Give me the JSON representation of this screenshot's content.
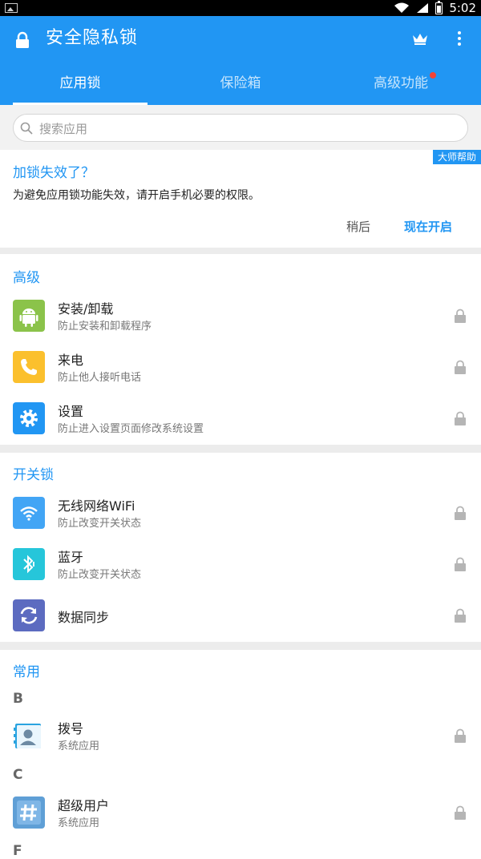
{
  "status": {
    "time": "5:02"
  },
  "appbar": {
    "title": "安全隐私锁"
  },
  "tabs": [
    {
      "label": "应用锁"
    },
    {
      "label": "保险箱"
    },
    {
      "label": "高级功能"
    }
  ],
  "search": {
    "placeholder": "搜索应用"
  },
  "banner": {
    "badge": "大师帮助",
    "title": "加锁失效了？",
    "desc": "为避免应用锁功能失效，请开启手机必要的权限。",
    "later": "稍后",
    "enable": "现在开启"
  },
  "sections": {
    "advanced": {
      "title": "高级",
      "items": [
        {
          "name": "安装/卸载",
          "sub": "防止安装和卸载程序",
          "icon": "android-icon",
          "color": "#8bc34a"
        },
        {
          "name": "来电",
          "sub": "防止他人接听电话",
          "icon": "phone-icon",
          "color": "#fbc02d"
        },
        {
          "name": "设置",
          "sub": "防止进入设置页面修改系统设置",
          "icon": "gear-icon",
          "color": "#2196f3"
        }
      ]
    },
    "switches": {
      "title": "开关锁",
      "items": [
        {
          "name": "无线网络WiFi",
          "sub": "防止改变开关状态",
          "icon": "wifi-icon",
          "color": "#42a5f5"
        },
        {
          "name": "蓝牙",
          "sub": "防止改变开关状态",
          "icon": "bluetooth-icon",
          "color": "#26c6da"
        },
        {
          "name": "数据同步",
          "sub": "",
          "icon": "sync-icon",
          "color": "#5c6bc0"
        }
      ]
    },
    "common": {
      "title": "常用",
      "groups": [
        {
          "letter": "B",
          "items": [
            {
              "name": "拨号",
              "sub": "系统应用",
              "icon": "dialer-icon"
            }
          ]
        },
        {
          "letter": "C",
          "items": [
            {
              "name": "超级用户",
              "sub": "系统应用",
              "icon": "superuser-icon"
            }
          ]
        },
        {
          "letter": "F"
        }
      ]
    }
  }
}
